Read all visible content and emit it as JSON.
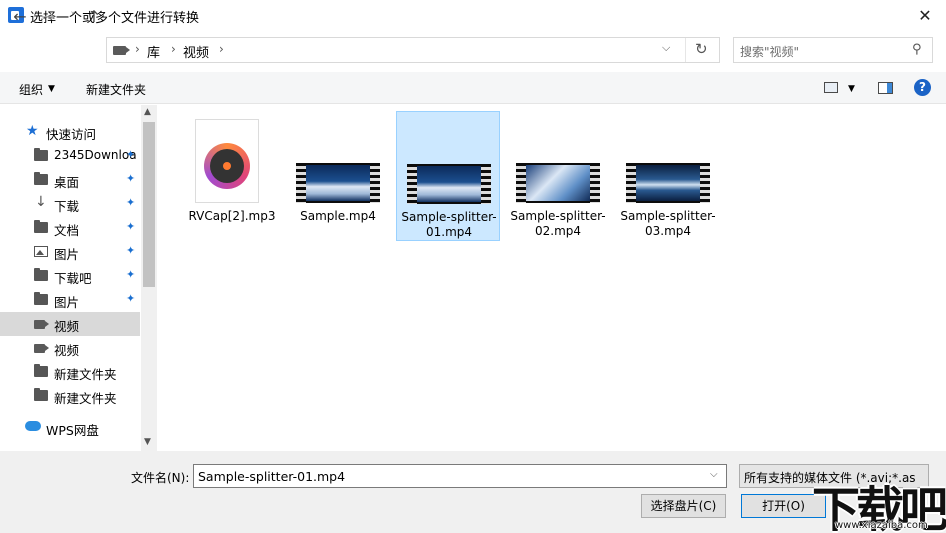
{
  "window": {
    "title": "选择一个或多个文件进行转换",
    "close": "✕"
  },
  "nav": {
    "back": "←",
    "forward": "→",
    "recent": "˅",
    "up": "↑",
    "breadcrumb": [
      "库",
      "视频"
    ],
    "sep": "›",
    "dropdown": "⌵",
    "refresh": "↻",
    "search_placeholder": "搜索\"视频\"",
    "search_icon": "⚲"
  },
  "toolbar": {
    "organize": "组织",
    "new_folder": "新建文件夹",
    "caret": "▼",
    "help": "?"
  },
  "sidebar": {
    "scroll_up": "▲",
    "scroll_down": "▼",
    "items": [
      {
        "label": "快速访问",
        "icon": "star-icon"
      },
      {
        "label": "2345Downloa",
        "icon": "folder-icon",
        "pinned": true
      },
      {
        "label": "桌面",
        "icon": "folder-icon",
        "pinned": true
      },
      {
        "label": "下载",
        "icon": "download-icon",
        "pinned": true
      },
      {
        "label": "文档",
        "icon": "folder-icon",
        "pinned": true
      },
      {
        "label": "图片",
        "icon": "image-icon",
        "pinned": true
      },
      {
        "label": "下载吧",
        "icon": "folder-icon",
        "pinned": true
      },
      {
        "label": "图片",
        "icon": "folder-icon",
        "pinned": true
      },
      {
        "label": "视频",
        "icon": "video-icon",
        "selected": true
      },
      {
        "label": "视频",
        "icon": "video-icon"
      },
      {
        "label": "新建文件夹",
        "icon": "folder-icon"
      },
      {
        "label": "新建文件夹",
        "icon": "folder-icon"
      },
      {
        "label": "WPS网盘",
        "icon": "cloud-icon"
      }
    ],
    "pin_glyph": "📌"
  },
  "files": [
    {
      "name": "RVCap[2].mp3",
      "kind": "audio"
    },
    {
      "name": "Sample.mp4",
      "kind": "video"
    },
    {
      "name": "Sample-splitter-01.mp4",
      "kind": "video",
      "selected": true
    },
    {
      "name": "Sample-splitter-02.mp4",
      "kind": "video"
    },
    {
      "name": "Sample-splitter-03.mp4",
      "kind": "video"
    }
  ],
  "bottom": {
    "filename_label": "文件名(N):",
    "filename_value": "Sample-splitter-01.mp4",
    "filetype": "所有支持的媒体文件 (*.avi;*.as",
    "dd": "⌵",
    "choose_drive": "选择盘片(C)",
    "open": "打开(O)"
  },
  "watermark": {
    "text": "下载吧",
    "url": "www.xiazaiba.com"
  }
}
